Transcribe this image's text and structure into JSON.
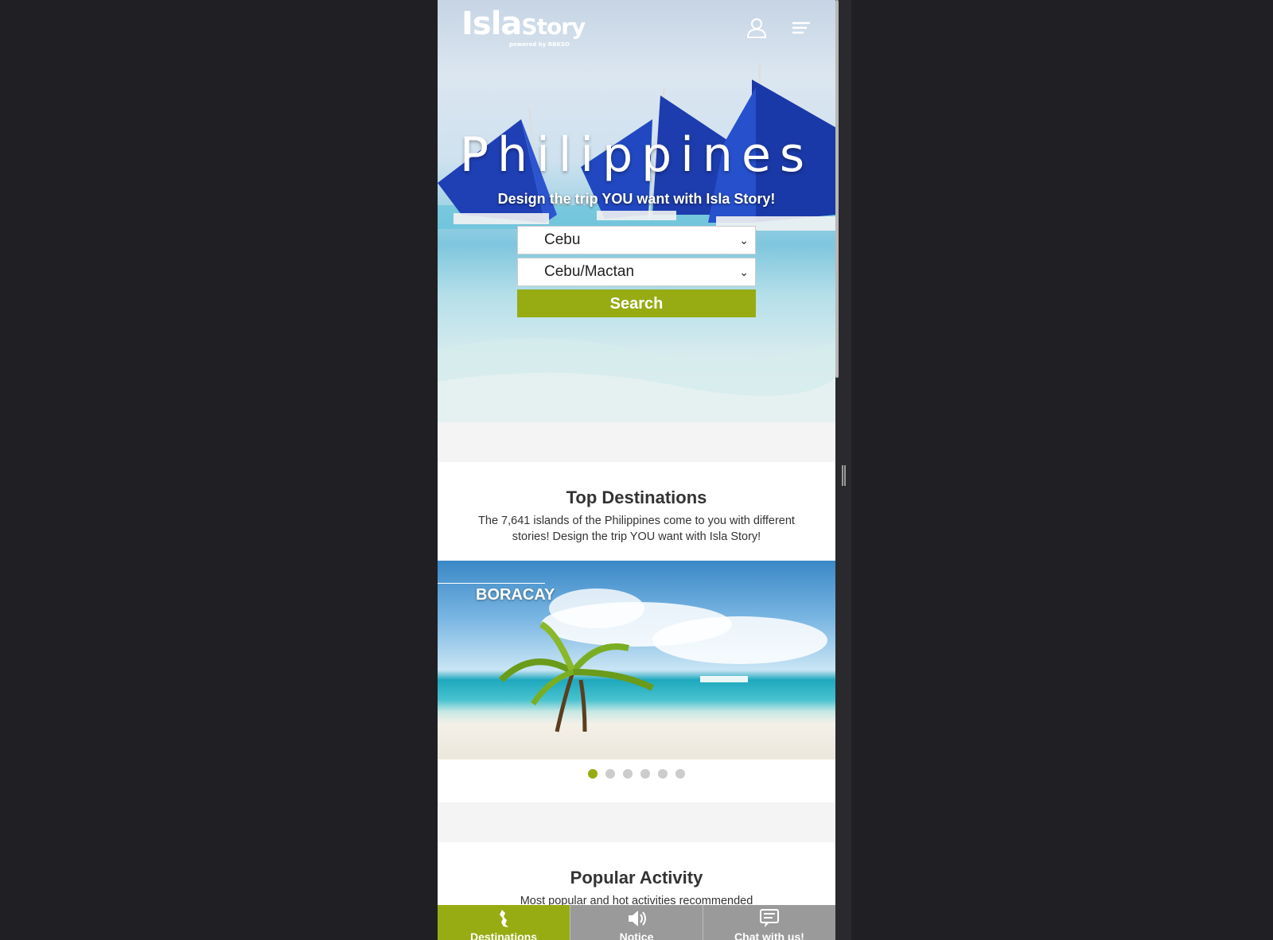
{
  "header": {
    "logo_main": "Isla",
    "logo_story": "Story",
    "logo_powered": "powered by RBKSO"
  },
  "hero": {
    "title": "Philippines",
    "subtitle": "Design the trip YOU want with Isla Story!",
    "region_select": "Cebu",
    "city_select": "Cebu/Mactan",
    "search_label": "Search"
  },
  "top_destinations": {
    "title": "Top Destinations",
    "description": "The 7,641 islands of the Philippines come to you with different stories! Design the trip YOU want with Isla Story!",
    "slide_label": "BORACAY",
    "slide_count": 6,
    "active_slide": 1
  },
  "popular_activity": {
    "title": "Popular Activity",
    "description": "Most popular and hot activities recommended"
  },
  "bottom_nav": [
    {
      "label": "Destinations",
      "icon": "philippines-map-icon"
    },
    {
      "label": "Notice",
      "icon": "speaker-icon"
    },
    {
      "label": "Chat with us!",
      "icon": "chat-icon"
    }
  ],
  "colors": {
    "accent": "#96ac12",
    "nav_inactive": "#9a9a9a",
    "page_bg": "#202024"
  }
}
